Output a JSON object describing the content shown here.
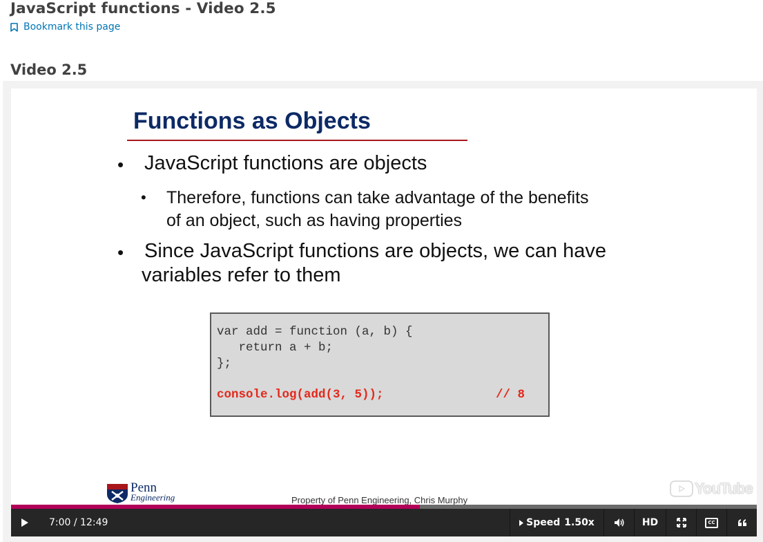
{
  "page": {
    "title": "JavaScript functions - Video 2.5",
    "bookmark_label": "Bookmark this page",
    "video_heading": "Video 2.5"
  },
  "slide": {
    "title": "Functions as Objects",
    "bullets": [
      "JavaScript functions are objects",
      "Therefore, functions can take advantage of the benefits",
      "of an object, such as having properties",
      "Since JavaScript functions are objects, we can have",
      "variables refer to them"
    ],
    "code": {
      "line1": "var add = function (a, b) {",
      "line2": "   return a + b;",
      "line3": "};",
      "line4": "console.log(add(3, 5));",
      "comment": "// 8"
    },
    "logo_penn": "Penn",
    "logo_engineering": "Engineering",
    "footer": "Property of Penn Engineering, Chris Murphy",
    "watermark": "YouTube"
  },
  "player": {
    "time_current": "7:00",
    "time_total": "12:49",
    "time_display": "7:00 / 12:49",
    "progress_fraction": 0.548,
    "speed_label": "Speed",
    "speed_value": "1.50x",
    "hd_label": "HD",
    "icons": [
      "play-icon",
      "volume-icon",
      "fullscreen-icon",
      "closed-captions-icon",
      "transcript-icon"
    ]
  },
  "colors": {
    "accent_link": "#0075b4",
    "progress_fill": "#b20058",
    "slide_title": "#0d2a66",
    "code_highlight": "#e3281b"
  }
}
